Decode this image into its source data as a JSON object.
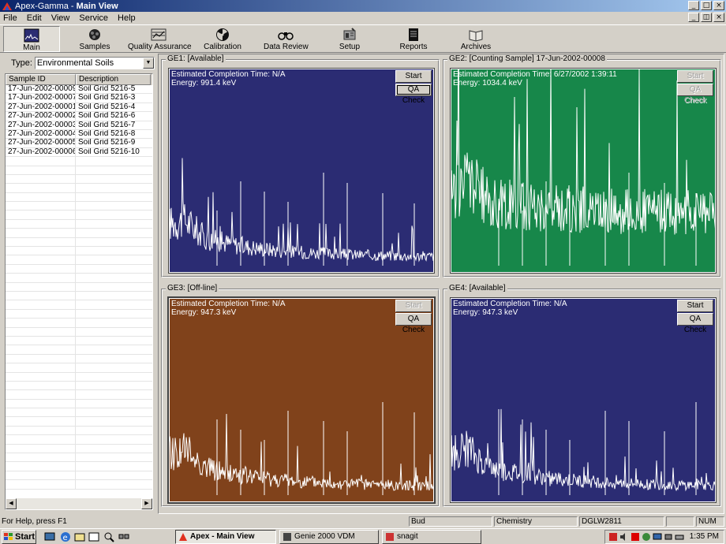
{
  "window": {
    "title_app": "Apex-Gamma",
    "title_sep": " - ",
    "title_view": "Main View"
  },
  "menu": [
    "File",
    "Edit",
    "View",
    "Service",
    "Help"
  ],
  "toolbar": [
    {
      "label": "Main",
      "icon": "main-icon",
      "active": true
    },
    {
      "label": "Samples",
      "icon": "samples-icon"
    },
    {
      "label": "Quality Assurance",
      "icon": "quality-assurance-icon"
    },
    {
      "label": "Calibration",
      "icon": "radiation-icon"
    },
    {
      "label": "Data Review",
      "icon": "binoculars-icon"
    },
    {
      "label": "Setup",
      "icon": "setup-icon"
    },
    {
      "label": "Reports",
      "icon": "reports-icon"
    },
    {
      "label": "Archives",
      "icon": "archives-icon"
    }
  ],
  "left": {
    "type_label": "Type:",
    "type_value": "Environmental Soils",
    "columns": [
      "Sample ID",
      "Description"
    ],
    "rows": [
      [
        "17-Jun-2002-00009",
        "Soil Grid 5216-5"
      ],
      [
        "17-Jun-2002-00007",
        "Soil Grid 5216-3"
      ],
      [
        "27-Jun-2002-00001",
        "Soil Grid 5216-4"
      ],
      [
        "27-Jun-2002-00002",
        "Soil Grid 5216-6"
      ],
      [
        "27-Jun-2002-00003",
        "Soil Grid 5216-7"
      ],
      [
        "27-Jun-2002-00004",
        "Soil Grid 5216-8"
      ],
      [
        "27-Jun-2002-00005",
        "Soil Grid 5216-9"
      ],
      [
        "27-Jun-2002-00006",
        "Soil Grid 5216-10"
      ]
    ]
  },
  "detectors": [
    {
      "label": "GE1: [Available]",
      "completion": "Estimated Completion Time: N/A",
      "energy": "Energy:  991.4 keV",
      "color": "#2b2c73",
      "start": "Start",
      "qa": "QA Check",
      "start_enabled": true,
      "qa_enabled": true
    },
    {
      "label": "GE2: [Counting Sample] 17-Jun-2002-00008",
      "completion": "Estimated Completion Time: 6/27/2002 1:39:11",
      "energy": "Energy:  1034.4 keV",
      "color": "#17874a",
      "start": "Start",
      "qa": "QA Check",
      "start_enabled": false,
      "qa_enabled": false
    },
    {
      "label": "GE3: [Off-line]",
      "completion": "Estimated Completion Time: N/A",
      "energy": "Energy:  947.3 keV",
      "color": "#80421b",
      "start": "Start",
      "qa": "QA Check",
      "start_enabled": false,
      "qa_enabled": true
    },
    {
      "label": "GE4: [Available]",
      "completion": "Estimated Completion Time: N/A",
      "energy": "Energy:  947.3 keV",
      "color": "#2b2c73",
      "start": "Start",
      "qa": "QA Check",
      "start_enabled": true,
      "qa_enabled": true
    }
  ],
  "status": {
    "help": "For Help, press F1",
    "user": "Bud",
    "dept": "Chemistry",
    "host": "DGLW2811",
    "num": "NUM"
  },
  "taskbar": {
    "start": "Start",
    "tasks": [
      "Apex - Main View",
      "Genie 2000 VDM",
      "snagit"
    ],
    "clock": "1:35 PM"
  }
}
